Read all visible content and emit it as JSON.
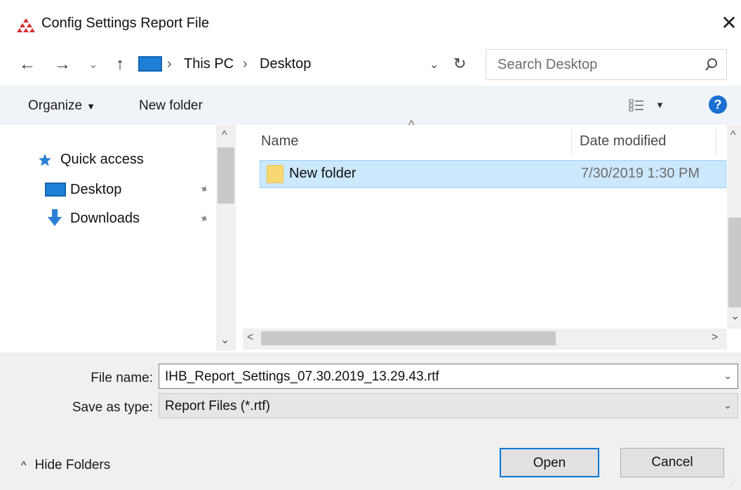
{
  "window": {
    "title": "Config Settings Report File",
    "close_glyph": "✕"
  },
  "navigation": {
    "back_glyph": "←",
    "forward_glyph": "→",
    "recent_glyph": "⌄",
    "up_glyph": "↑",
    "breadcrumb": [
      "This PC",
      "Desktop"
    ],
    "breadcrumb_sep": "›",
    "dropdown_glyph": "⌄",
    "refresh_glyph": "↻"
  },
  "search": {
    "placeholder": "Search Desktop"
  },
  "toolbar": {
    "organize_label": "Organize",
    "organize_arrow": "▼",
    "new_folder_label": "New folder",
    "view_arrow": "▼",
    "help_glyph": "?"
  },
  "nav_pane": {
    "items": [
      {
        "label": "Quick access",
        "icon": "star-icon",
        "pinned": false
      },
      {
        "label": "Desktop",
        "icon": "desktop-icon",
        "pinned": true
      },
      {
        "label": "Downloads",
        "icon": "download-icon",
        "pinned": true
      }
    ],
    "pin_glyph": "📌"
  },
  "file_list": {
    "columns": [
      "Name",
      "Date modified"
    ],
    "sort_caret": "^",
    "rows": [
      {
        "name": "New folder",
        "date_modified": "7/30/2019 1:30 PM",
        "selected": true
      }
    ]
  },
  "scrollbars": {
    "up_glyph": "^",
    "down_glyph": "⌄",
    "left_glyph": "<",
    "right_glyph": ">"
  },
  "form": {
    "file_name_label": "File name:",
    "file_name_value": "IHB_Report_Settings_07.30.2019_13.29.43.rtf",
    "save_as_type_label": "Save as type:",
    "save_as_type_value": "Report Files (*.rtf)",
    "dropdown_glyph": "⌄"
  },
  "footer": {
    "hide_folders_label": "Hide Folders",
    "hide_folders_glyph": "^",
    "open_label": "Open",
    "cancel_label": "Cancel"
  },
  "colors": {
    "accent": "#0078d7",
    "selection_bg": "#cce8ff",
    "toolbar_bg": "#f0f4f9",
    "footer_bg": "#f0f0f0",
    "app_icon": "#d32f2f"
  }
}
